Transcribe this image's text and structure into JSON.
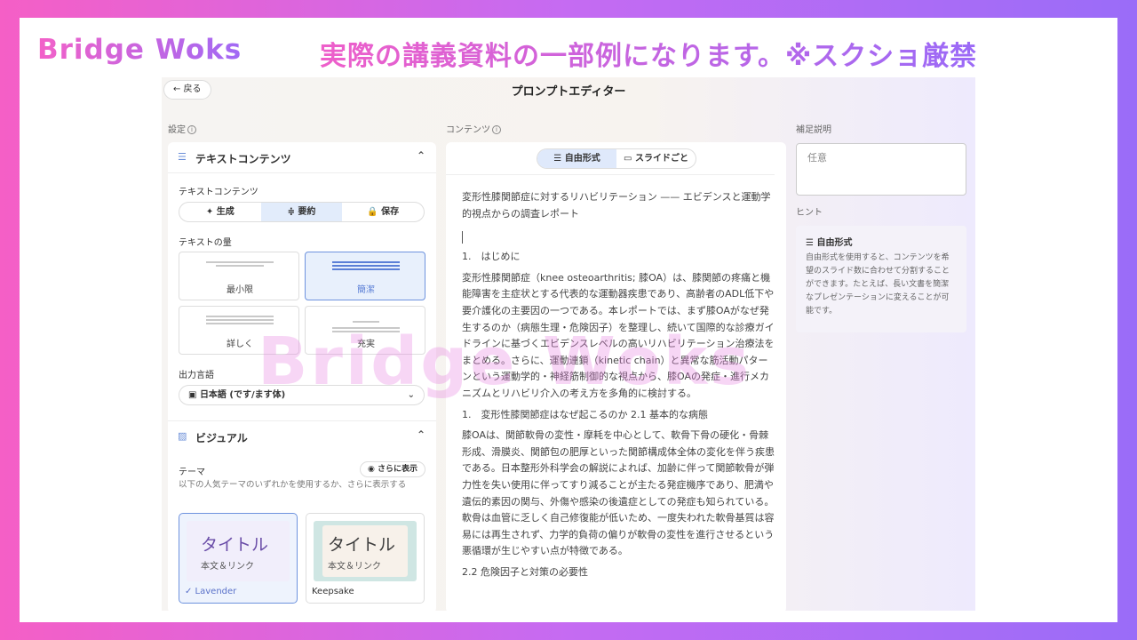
{
  "overlay": {
    "brand": "Bridge Woks",
    "notice": "実際の講義資料の一部例になります。※スクショ厳禁",
    "watermark": "Bridge Woks"
  },
  "header": {
    "back_label": "← 戻る",
    "title": "プロンプトエディター"
  },
  "sections": {
    "settings": "設定",
    "content": "コンテンツ",
    "supplement": "補足説明",
    "hint": "ヒント"
  },
  "text_content": {
    "heading": "テキストコンテンツ",
    "label": "テキストコンテンツ",
    "modes": [
      "✦ 生成",
      "≑ 要約",
      "🔒 保存"
    ],
    "selected_mode": "要約",
    "amount_label": "テキストの量",
    "amounts": [
      "最小限",
      "簡潔",
      "詳しく",
      "充実"
    ],
    "selected_amount": "簡潔",
    "language_label": "出力言語",
    "language_value": "日本語 (です/ます体)"
  },
  "visual": {
    "heading": "ビジュアル",
    "theme_label": "テーマ",
    "more_label": "さらに表示",
    "theme_desc": "以下の人気テーマのいずれかを使用するか、さらに表示する",
    "themes": [
      {
        "name": "✓ Lavender",
        "title": "タイトル",
        "sub": "本文＆リンク"
      },
      {
        "name": "Keepsake",
        "title": "タイトル",
        "sub": "本文＆リンク"
      }
    ]
  },
  "content_tabs": [
    "☰ 自由形式",
    "▭ スライドごと"
  ],
  "document": {
    "title": "変形性膝関節症に対するリハビリテーション —— エビデンスと運動学的視点からの調査レポート",
    "h1": "1.　はじめに",
    "p1": "変形性膝関節症（knee osteoarthritis; 膝OA）は、膝関節の疼痛と機能障害を主症状とする代表的な運動器疾患であり、高齢者のADL低下や要介護化の主要因の一つである。本レポートでは、まず膝OAがなぜ発生するのか（病態生理・危険因子）を整理し、続いて国際的な診療ガイドラインに基づくエビデンスレベルの高いリハビリテーション治療法をまとめる。さらに、運動連鎖（kinetic chain）と異常な筋活動パターンという運動学的・神経筋制御的な視点から、膝OAの発症・進行メカニズムとリハビリ介入の考え方を多角的に検討する。",
    "h2": "1.　変形性膝関節症はなぜ起こるのか 2.1 基本的な病態",
    "p2": "膝OAは、関節軟骨の変性・摩耗を中心として、軟骨下骨の硬化・骨棘形成、滑膜炎、関節包の肥厚といった関節構成体全体の変化を伴う疾患である。日本整形外科学会の解説によれば、加齢に伴って関節軟骨が弾力性を失い使用に伴ってすり減ることが主たる発症機序であり、肥満や遺伝的素因の関与、外傷や感染の後遺症としての発症も知られている。軟骨は血管に乏しく自己修復能が低いため、一度失われた軟骨基質は容易には再生されず、力学的負荷の偏りが軟骨の変性を進行させるという悪循環が生じやすい点が特徴である。",
    "h3": "2.2 危険因子と対策の必要性"
  },
  "memo": {
    "placeholder": "任意"
  },
  "hint_card": {
    "title": "☰ 自由形式",
    "body": "自由形式を使用すると、コンテンツを希望のスライド数に合わせて分割することができます。たとえば、長い文書を簡潔なプレゼンテーションに変えることが可能です。"
  }
}
